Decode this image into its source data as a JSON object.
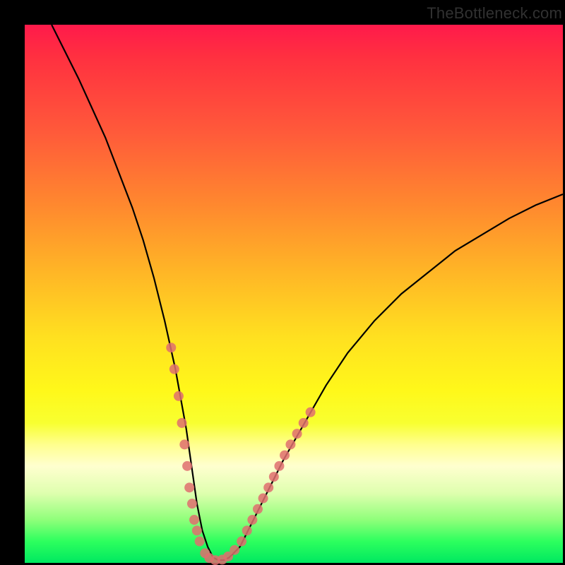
{
  "watermark": "TheBottleneck.com",
  "chart_data": {
    "type": "line",
    "title": "",
    "xlabel": "",
    "ylabel": "",
    "xlim": [
      0,
      100
    ],
    "ylim": [
      0,
      100
    ],
    "series": [
      {
        "name": "bottleneck-curve",
        "color": "#000000",
        "x": [
          5,
          10,
          15,
          20,
          22,
          24,
          26,
          28,
          30,
          31,
          32,
          33,
          34,
          35,
          36,
          37,
          38,
          40,
          42,
          45,
          48,
          52,
          56,
          60,
          65,
          70,
          75,
          80,
          85,
          90,
          95,
          100
        ],
        "y": [
          100,
          90,
          79,
          66,
          60,
          53,
          45,
          36,
          25,
          18,
          11,
          6,
          3,
          1,
          0.5,
          0.5,
          1,
          3,
          7,
          13,
          19,
          26,
          33,
          39,
          45,
          50,
          54,
          58,
          61,
          64,
          66.5,
          68.5
        ]
      },
      {
        "name": "sample-markers-left",
        "type": "scatter",
        "color": "#df6f6f",
        "x": [
          27.2,
          27.8,
          28.6,
          29.2,
          29.7,
          30.2,
          30.6,
          31.1,
          31.5,
          32.0,
          32.5
        ],
        "y": [
          40,
          36,
          31,
          26,
          22,
          18,
          14,
          11,
          8,
          6,
          4
        ]
      },
      {
        "name": "sample-markers-bottom",
        "type": "scatter",
        "color": "#df6f6f",
        "x": [
          33.5,
          34.3,
          35.4,
          36.7,
          37.8,
          39.0
        ],
        "y": [
          1.8,
          0.9,
          0.5,
          0.6,
          1.2,
          2.4
        ]
      },
      {
        "name": "sample-markers-right",
        "type": "scatter",
        "color": "#df6f6f",
        "x": [
          40.3,
          41.3,
          42.3,
          43.3,
          44.3,
          45.3,
          46.3,
          47.3,
          48.3,
          49.4,
          50.6,
          51.8,
          53.1
        ],
        "y": [
          4,
          6,
          8,
          10,
          12,
          14,
          16,
          18,
          20,
          22,
          24,
          26,
          28
        ]
      }
    ]
  }
}
